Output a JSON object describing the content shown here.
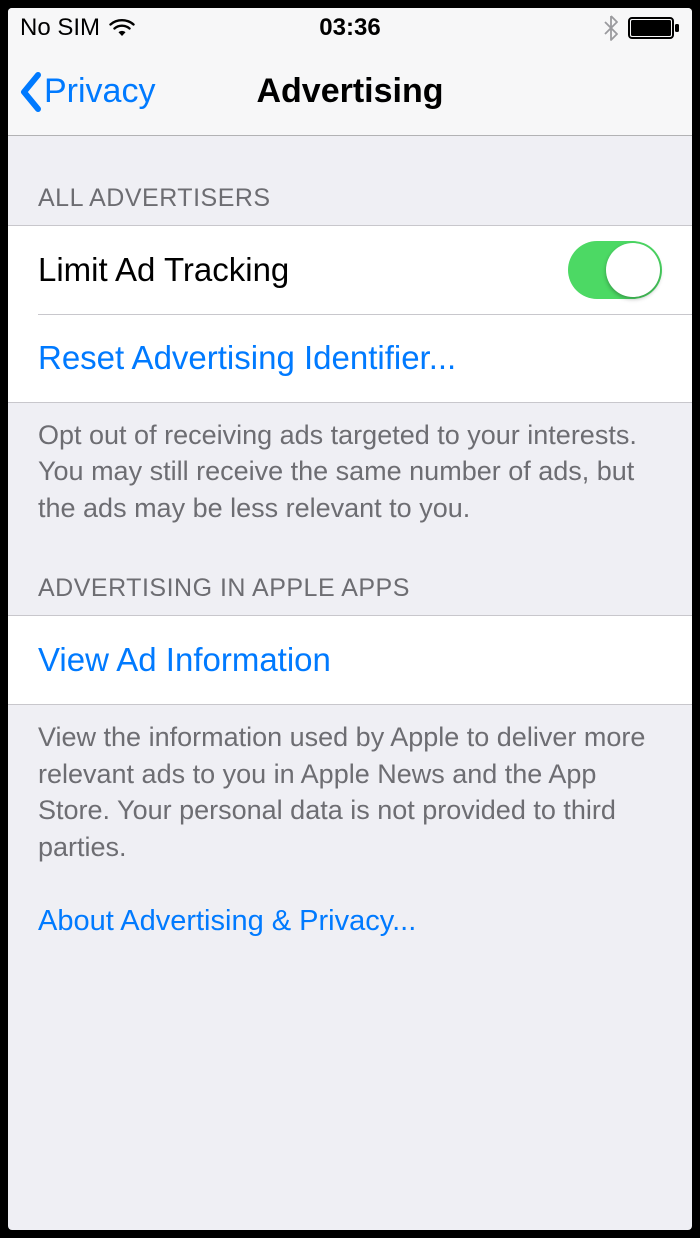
{
  "status_bar": {
    "carrier": "No SIM",
    "time": "03:36"
  },
  "nav": {
    "back_label": "Privacy",
    "title": "Advertising"
  },
  "sections": {
    "advertisers": {
      "header": "ALL ADVERTISERS",
      "limit_ad_tracking_label": "Limit Ad Tracking",
      "limit_ad_tracking_on": true,
      "reset_label": "Reset Advertising Identifier...",
      "footer": "Opt out of receiving ads targeted to your interests. You may still receive the same number of ads, but the ads may be less relevant to you."
    },
    "apple_apps": {
      "header": "ADVERTISING IN APPLE APPS",
      "view_info_label": "View Ad Information",
      "footer": "View the information used by Apple to deliver more relevant ads to you in Apple News and the App Store. Your personal data is not provided to third parties.",
      "about_link": "About Advertising & Privacy..."
    }
  },
  "colors": {
    "link": "#007aff",
    "switch_on": "#4cd964",
    "background": "#efeff4"
  }
}
